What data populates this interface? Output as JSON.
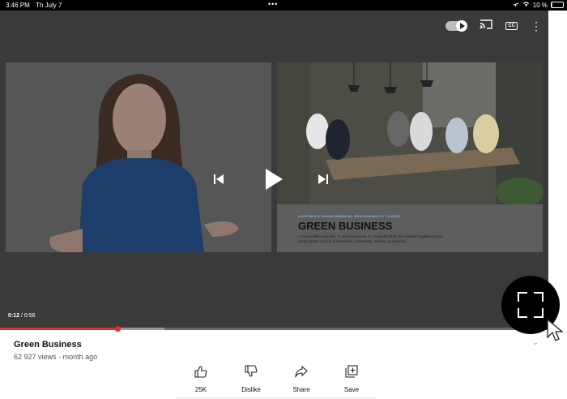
{
  "status_bar": {
    "time": "3:46 PM",
    "date": "Th July 7",
    "dots": "•••",
    "battery_text": "10 %",
    "battery_level": 0.1,
    "battery_color": "#f39c12"
  },
  "player": {
    "icons": [
      "autoplay-toggle-icon",
      "cast-icon",
      "captions-icon",
      "more-icon",
      "previous-icon",
      "play-icon",
      "next-icon",
      "fullscreen-icon"
    ],
    "captions_label": "CC",
    "current_time": "0:12",
    "separator": " / ",
    "duration": "0:56",
    "progress_fraction": 0.214,
    "buffered_fraction": 0.3,
    "progress_color": "#e52d27",
    "slide": {
      "kicker": "CORPORATE ENVIRONMENTAL RESPONSIBILITY COURSE",
      "heading": "GREEN BUSINESS",
      "body": "A sustainable business, or green business, is a business that has minimal negative impact on the global or local environment, community, society, or economy."
    }
  },
  "video": {
    "title": "Green Business",
    "views": "62 927",
    "views_label": "views",
    "age": "month ago"
  },
  "actions": [
    {
      "label": "25K",
      "icon": "like-icon"
    },
    {
      "label": "Dislike",
      "icon": "dislike-icon"
    },
    {
      "label": "Share",
      "icon": "share-icon"
    },
    {
      "label": "Save",
      "icon": "save-icon"
    }
  ]
}
